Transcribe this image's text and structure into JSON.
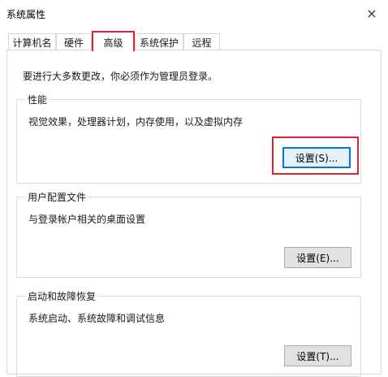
{
  "window": {
    "title": "系统属性",
    "close_icon": "×"
  },
  "tabs": [
    {
      "label": "计算机名"
    },
    {
      "label": "硬件"
    },
    {
      "label": "高级"
    },
    {
      "label": "系统保护"
    },
    {
      "label": "远程"
    }
  ],
  "active_tab": "高级",
  "intro": "要进行大多数更改，你必须作为管理员登录。",
  "groups": {
    "performance": {
      "title": "性能",
      "description": "视觉效果，处理器计划，内存使用，以及虚拟内存",
      "button": "设置(S)..."
    },
    "user_profiles": {
      "title": "用户配置文件",
      "description": "与登录帐户相关的桌面设置",
      "button": "设置(E)..."
    },
    "startup_recovery": {
      "title": "启动和故障恢复",
      "description": "系统启动、系统故障和调试信息",
      "button": "设置(T)..."
    }
  },
  "colors": {
    "highlight": "#e0212f",
    "focus_border": "#0078d7"
  }
}
